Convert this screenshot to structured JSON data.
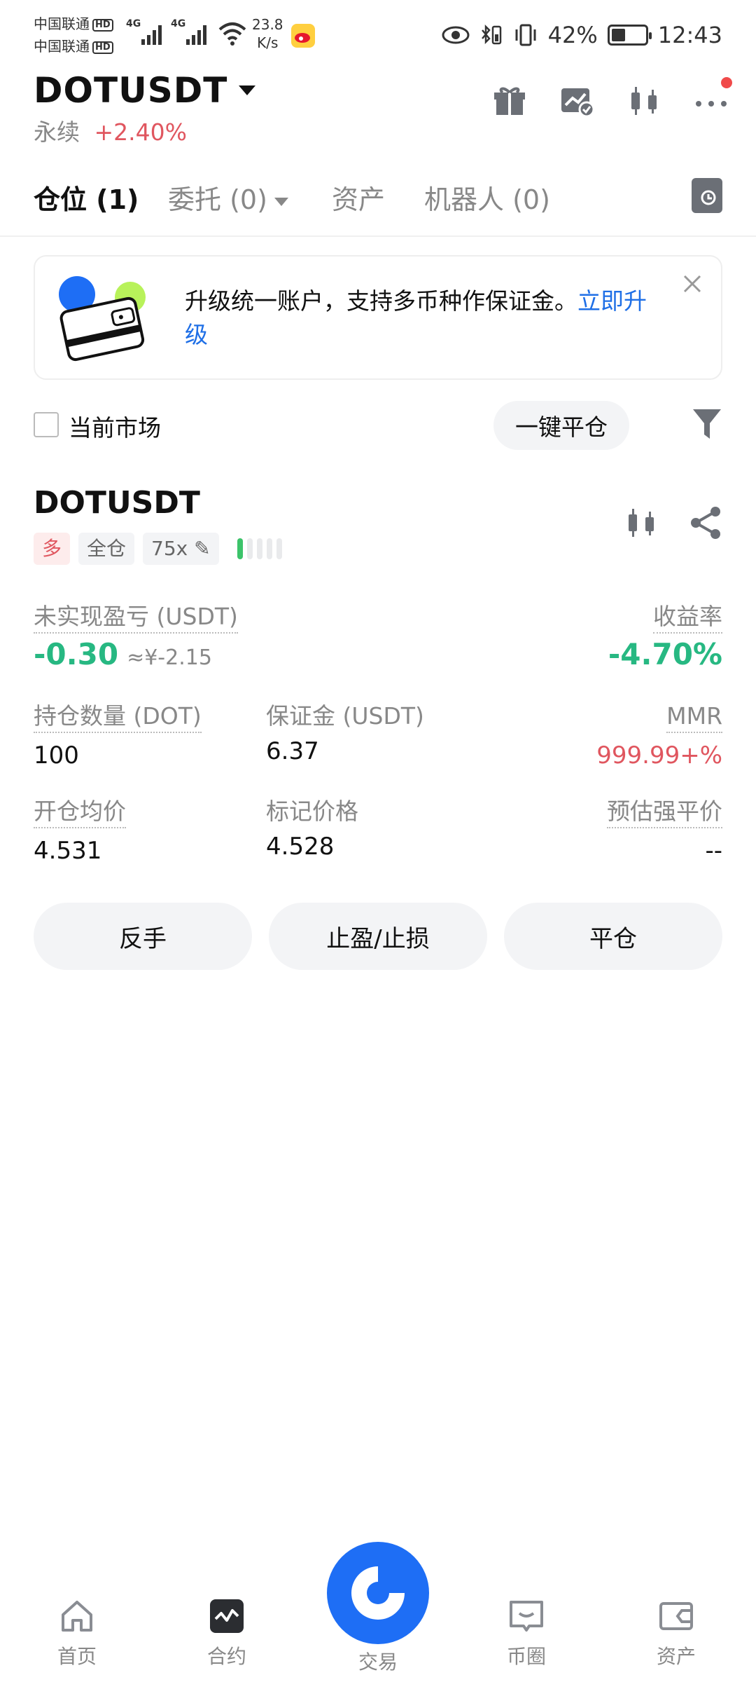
{
  "status_bar": {
    "carrier1": "中国联通",
    "carrier2": "中国联通",
    "hd": "HD",
    "net1": "4G",
    "net2": "4G",
    "speed_value": "23.8",
    "speed_unit": "K/s",
    "battery": "42%",
    "battery_level": 0.42,
    "time": "12:43"
  },
  "header": {
    "symbol": "DOTUSDT",
    "type": "永续",
    "change": "+2.40%"
  },
  "tabs": {
    "positions": "仓位 (1)",
    "orders": "委托 (0)",
    "assets": "资产",
    "bots": "机器人 (0)"
  },
  "banner": {
    "text": "升级统一账户，支持多币种作保证金。",
    "link": "立即升级"
  },
  "filter": {
    "current_market": "当前市场",
    "close_all": "一键平仓"
  },
  "position": {
    "symbol": "DOTUSDT",
    "side": "多",
    "margin_mode": "全仓",
    "leverage": "75x",
    "risk_level": 1,
    "unrealized_pnl_label": "未实现盈亏 (USDT)",
    "unrealized_pnl": "-0.30",
    "unrealized_pnl_cny": "≈¥-2.15",
    "roe_label": "收益率",
    "roe": "-4.70%",
    "size_label": "持仓数量 (DOT)",
    "size": "100",
    "margin_label": "保证金 (USDT)",
    "margin": "6.37",
    "mmr_label": "MMR",
    "mmr": "999.99+%",
    "entry_label": "开仓均价",
    "entry": "4.531",
    "mark_label": "标记价格",
    "mark": "4.528",
    "liq_label": "预估强平价",
    "liq": "--"
  },
  "actions": {
    "reverse": "反手",
    "tpsl": "止盈/止损",
    "close": "平仓"
  },
  "bottom_nav": {
    "home": "首页",
    "futures": "合约",
    "trade": "交易",
    "community": "币圈",
    "assets": "资产"
  }
}
